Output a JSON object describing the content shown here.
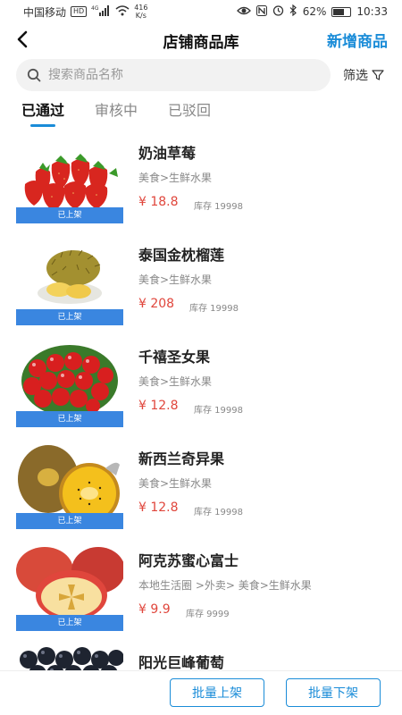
{
  "status_bar": {
    "carrier": "中国移动",
    "hd": "HD",
    "net_type": "4G",
    "speed_value": "416",
    "speed_unit": "K/s",
    "battery": "62%",
    "battery_level": 0.62,
    "time": "10:33"
  },
  "header": {
    "title": "店铺商品库",
    "add_label": "新增商品"
  },
  "search": {
    "placeholder": "搜索商品名称",
    "value": "",
    "filter_label": "筛选"
  },
  "tabs": [
    {
      "label": "已通过",
      "active": true
    },
    {
      "label": "审核中",
      "active": false
    },
    {
      "label": "已驳回",
      "active": false
    }
  ],
  "products": [
    {
      "name": "奶油草莓",
      "category": "美食>生鲜水果",
      "price": "¥ 18.8",
      "stock": "库存 19998",
      "status": "已上架",
      "image": "strawberry-image"
    },
    {
      "name": "泰国金枕榴莲",
      "category": "美食>生鲜水果",
      "price": "¥ 208",
      "stock": "库存 19998",
      "status": "已上架",
      "image": "durian-image"
    },
    {
      "name": "千禧圣女果",
      "category": "美食>生鲜水果",
      "price": "¥ 12.8",
      "stock": "库存 19998",
      "status": "已上架",
      "image": "cherry-tomato-image"
    },
    {
      "name": "新西兰奇异果",
      "category": "美食>生鲜水果",
      "price": "¥ 12.8",
      "stock": "库存 19998",
      "status": "已上架",
      "image": "kiwi-image"
    },
    {
      "name": "阿克苏蜜心富士",
      "category": "本地生活圈 >外卖> 美食>生鲜水果",
      "price": "¥ 9.9",
      "stock": "库存 9999",
      "status": "已上架",
      "image": "apple-image"
    },
    {
      "name": "阳光巨峰葡萄",
      "category": "",
      "price": "",
      "stock": "",
      "status": "",
      "image": "grape-image"
    }
  ],
  "bottom_bar": {
    "bulk_on_label": "批量上架",
    "bulk_off_label": "批量下架"
  },
  "colors": {
    "accent": "#1a8cd8",
    "price": "#e0463c",
    "status_tag": "#3a86e0"
  }
}
